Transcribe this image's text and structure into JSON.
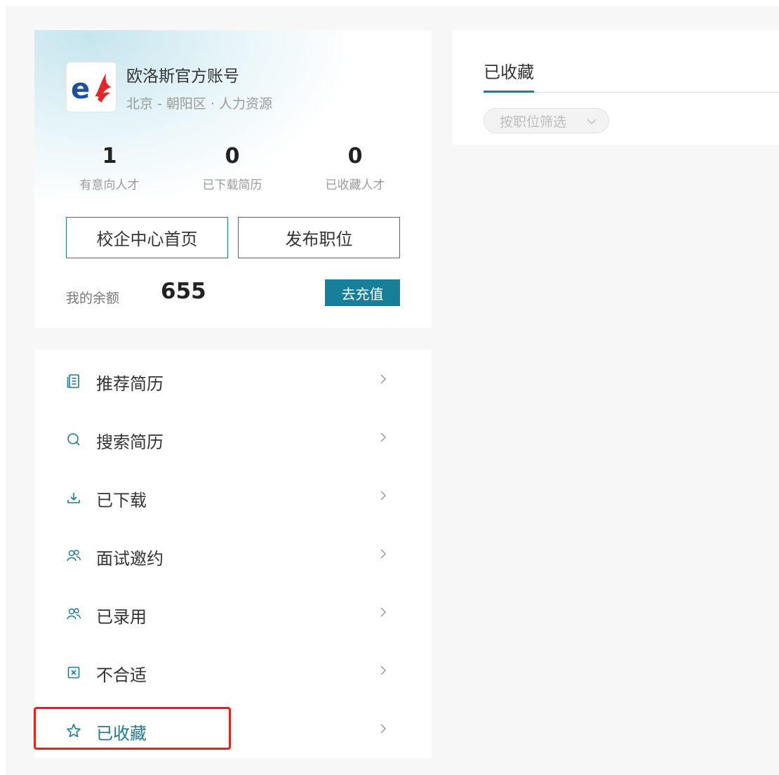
{
  "profile": {
    "company_name": "欧洛斯官方账号",
    "company_meta": "北京 - 朝阳区 · 人力资源",
    "logo_letter": "e",
    "stats": [
      {
        "value": "1",
        "label": "有意向人才"
      },
      {
        "value": "0",
        "label": "已下载简历"
      },
      {
        "value": "0",
        "label": "已收藏人才"
      }
    ],
    "buttons": {
      "home": "校企中心首页",
      "publish": "发布职位"
    },
    "balance_label": "我的余额",
    "balance_value": "655",
    "recharge": "去充值"
  },
  "menu": [
    {
      "label": "推荐简历",
      "icon": "document-list-icon"
    },
    {
      "label": "搜索简历",
      "icon": "search-icon"
    },
    {
      "label": "已下载",
      "icon": "download-icon"
    },
    {
      "label": "面试邀约",
      "icon": "people-icon"
    },
    {
      "label": "已录用",
      "icon": "people-icon"
    },
    {
      "label": "不合适",
      "icon": "close-box-icon"
    },
    {
      "label": "已收藏",
      "icon": "star-icon",
      "highlighted": true
    }
  ],
  "panel": {
    "tab_label": "已收藏",
    "filter_placeholder": "按职位筛选"
  },
  "colors": {
    "accent": "#177f98",
    "highlight": "#e2231a",
    "logo_blue": "#1d4fa3",
    "logo_red": "#e3262a"
  }
}
